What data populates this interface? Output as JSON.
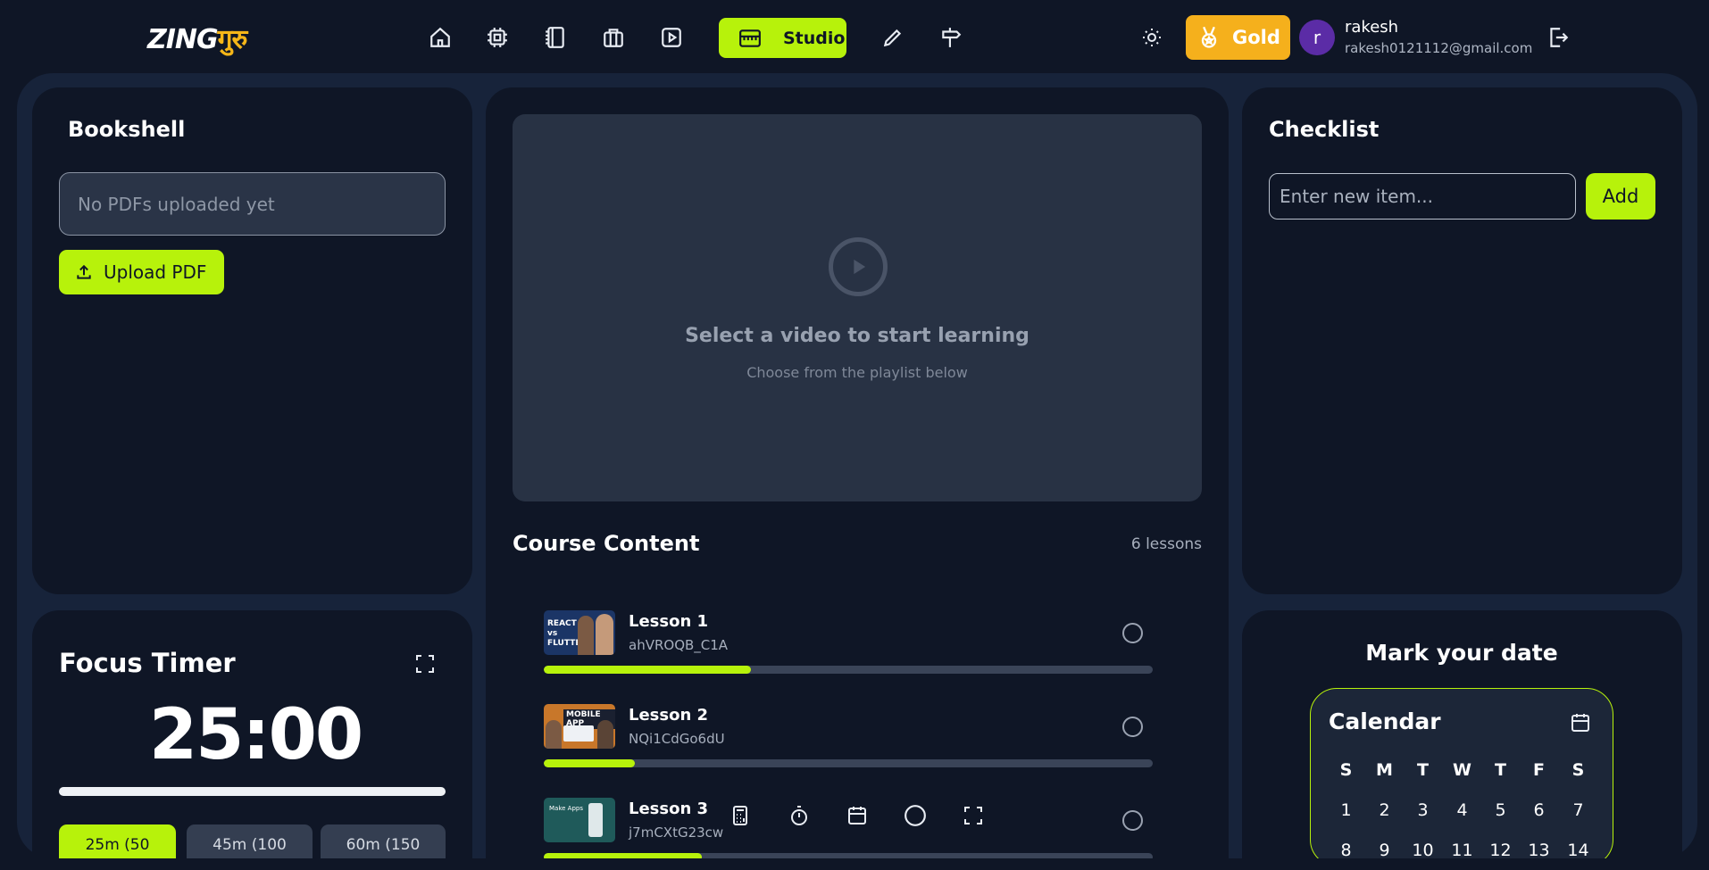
{
  "brand": {
    "logo_latin": "ZING",
    "logo_devanagari": "गुरु"
  },
  "nav": {
    "icons": [
      "home-icon",
      "cpu-icon",
      "notebook-icon",
      "briefcase-icon",
      "play-square-icon"
    ],
    "studio_label": "Studio",
    "after_icons": [
      "pencil-icon",
      "signpost-icon"
    ]
  },
  "account": {
    "tier_label": "Gold",
    "avatar_initial": "r",
    "name": "rakesh",
    "email": "rakesh0121112@gmail.com"
  },
  "bookshelf": {
    "title": "Bookshell",
    "empty_text": "No PDFs uploaded yet",
    "upload_label": "Upload PDF"
  },
  "focus_timer": {
    "title": "Focus Timer",
    "time": "25:00",
    "progress": 1.0,
    "presets": [
      "25m (50",
      "45m (100",
      "60m (150"
    ],
    "active_preset": 0
  },
  "player": {
    "title": "Select a video to start learning",
    "subtitle": "Choose from the playlist below"
  },
  "course": {
    "title": "Course Content",
    "count_label": "6 lessons",
    "lessons": [
      {
        "title": "Lesson 1",
        "id": "ahVROQB_C1A",
        "progress": 0.34,
        "thumb_text": "REACT vs FLUTTER"
      },
      {
        "title": "Lesson 2",
        "id": "NQi1CdGo6dU",
        "progress": 0.15,
        "thumb_text": "MOBILE APP"
      },
      {
        "title": "Lesson 3",
        "id": "j7mCXtG23cw",
        "progress": 0.26,
        "thumb_text": "Make Apps"
      }
    ]
  },
  "bottom_toolbar": [
    "calculator-icon",
    "stopwatch-icon",
    "calendar-icon",
    "circle-icon",
    "fullscreen-icon"
  ],
  "checklist": {
    "title": "Checklist",
    "placeholder": "Enter new item...",
    "add_label": "Add"
  },
  "calendar": {
    "heading": "Mark your date",
    "title": "Calendar",
    "weekdays": [
      "S",
      "M",
      "T",
      "W",
      "T",
      "F",
      "S"
    ],
    "week1": [
      "1",
      "2",
      "3",
      "4",
      "5",
      "6",
      "7"
    ],
    "week2": [
      "8",
      "9",
      "10",
      "11",
      "12",
      "13",
      "14"
    ]
  },
  "colors": {
    "accent": "#b7f20b",
    "gold": "#f5b01c",
    "bg": "#0f1626",
    "panel_frame": "#17233a"
  }
}
